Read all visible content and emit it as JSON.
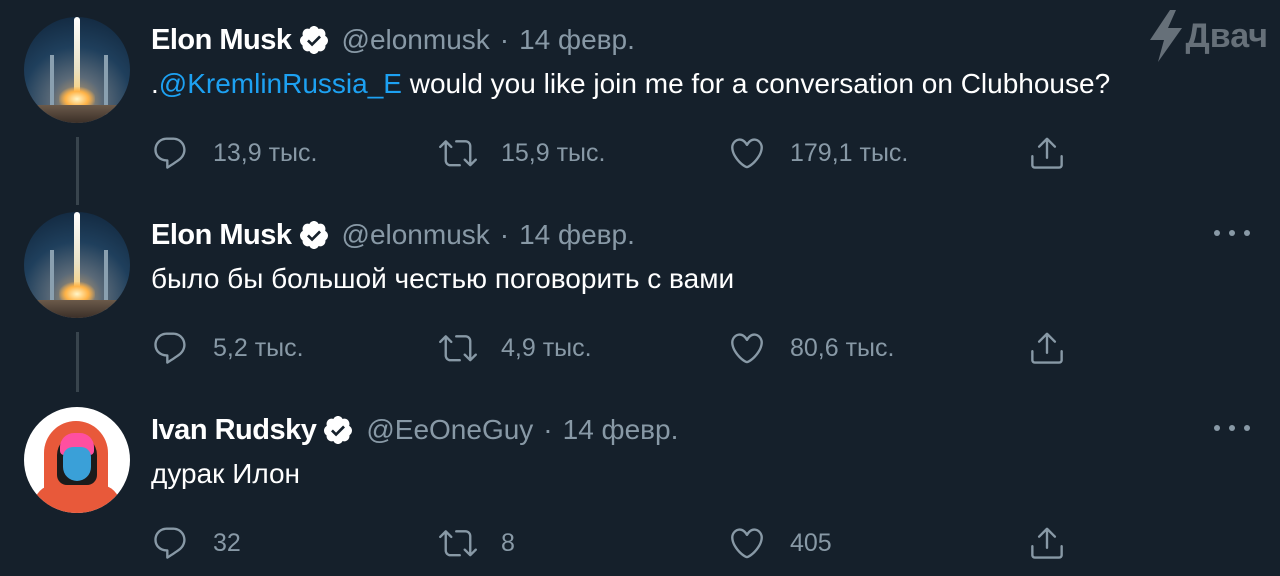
{
  "watermark": {
    "text": "Двач"
  },
  "tweets": [
    {
      "name": "Elon Musk",
      "handle": "@elonmusk",
      "separator": "·",
      "date": "14 февр.",
      "text_prefix": ".",
      "mention": "@KremlinRussia_E",
      "text": " would you like join me for a conversation on Clubhouse?",
      "replies": "13,9 тыс.",
      "retweets": "15,9 тыс.",
      "likes": "179,1 тыс.",
      "verified": true,
      "avatar": "rocket-launch-avatar"
    },
    {
      "name": "Elon Musk",
      "handle": "@elonmusk",
      "separator": "·",
      "date": "14 февр.",
      "text": "было бы большой честью поговорить с вами",
      "replies": "5,2 тыс.",
      "retweets": "4,9 тыс.",
      "likes": "80,6 тыс.",
      "verified": true,
      "avatar": "rocket-launch-avatar"
    },
    {
      "name": "Ivan Rudsky",
      "handle": "@EeOneGuy",
      "separator": "·",
      "date": "14 февр.",
      "text": "дурак Илон",
      "replies": "32",
      "retweets": "8",
      "likes": "405",
      "verified": true,
      "avatar": "hooded-character-avatar"
    }
  ],
  "colors": {
    "background": "#15202b",
    "text": "#ffffff",
    "secondary": "#8899a6",
    "link": "#1da1f2",
    "thread_line": "#38444d"
  }
}
